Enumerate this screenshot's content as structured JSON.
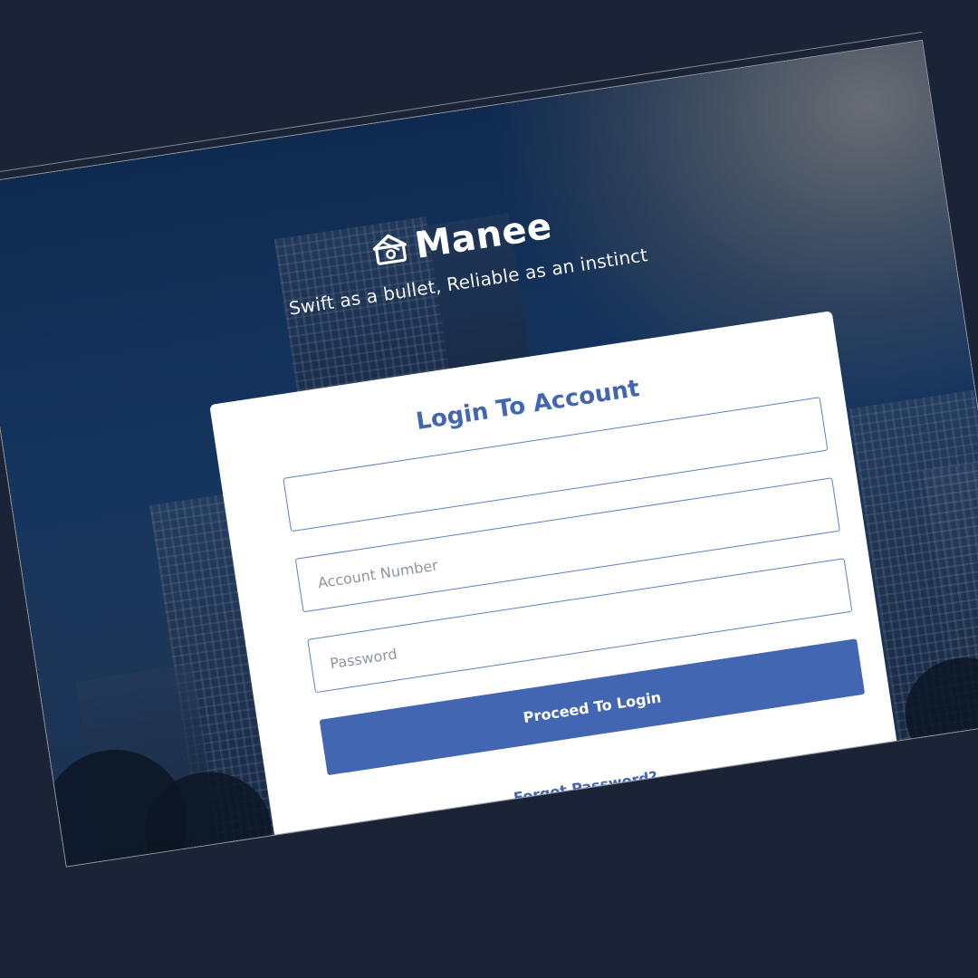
{
  "brand": {
    "name": "Manee",
    "tagline": "Swift as a bullet, Reliable as an instinct",
    "logo_icon": "money-house-icon"
  },
  "login": {
    "title": "Login To Account",
    "top_field_value": "",
    "account_number_placeholder": "Account Number",
    "password_placeholder": "Password",
    "submit_label": "Proceed To Login",
    "forgot_label": "Forgot Password?"
  },
  "colors": {
    "page_background": "#1b2336",
    "accent": "#4266b2",
    "card": "#ffffff"
  }
}
